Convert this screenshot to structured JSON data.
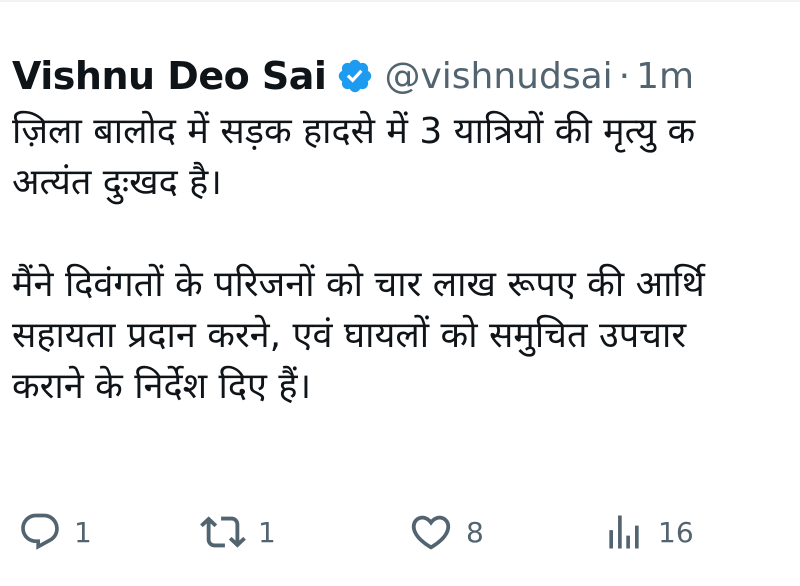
{
  "tweet": {
    "author_name": "Vishnu Deo Sai",
    "handle": "@vishnudsai",
    "separator": "·",
    "time": "1m",
    "paragraphs": [
      [
        "ज़िला बालोद में सड़क हादसे में 3 यात्रियों की मृत्यु क",
        "अत्यंत दुःखद है।"
      ],
      [
        "मैंने दिवंगतों के परिजनों को चार लाख रूपए की आर्थि",
        "सहायता प्रदान करने, एवं घायलों को समुचित उपचार",
        "कराने के निर्देश दिए हैं।"
      ]
    ]
  },
  "actions": {
    "reply_count": "1",
    "retweet_count": "1",
    "like_count": "8",
    "views_count": "16"
  },
  "colors": {
    "text": "#0f1419",
    "secondary": "#536471",
    "verified_blue": "#1d9bf0"
  },
  "icons": [
    "verified-badge-icon",
    "reply-icon",
    "retweet-icon",
    "like-icon",
    "views-icon"
  ]
}
